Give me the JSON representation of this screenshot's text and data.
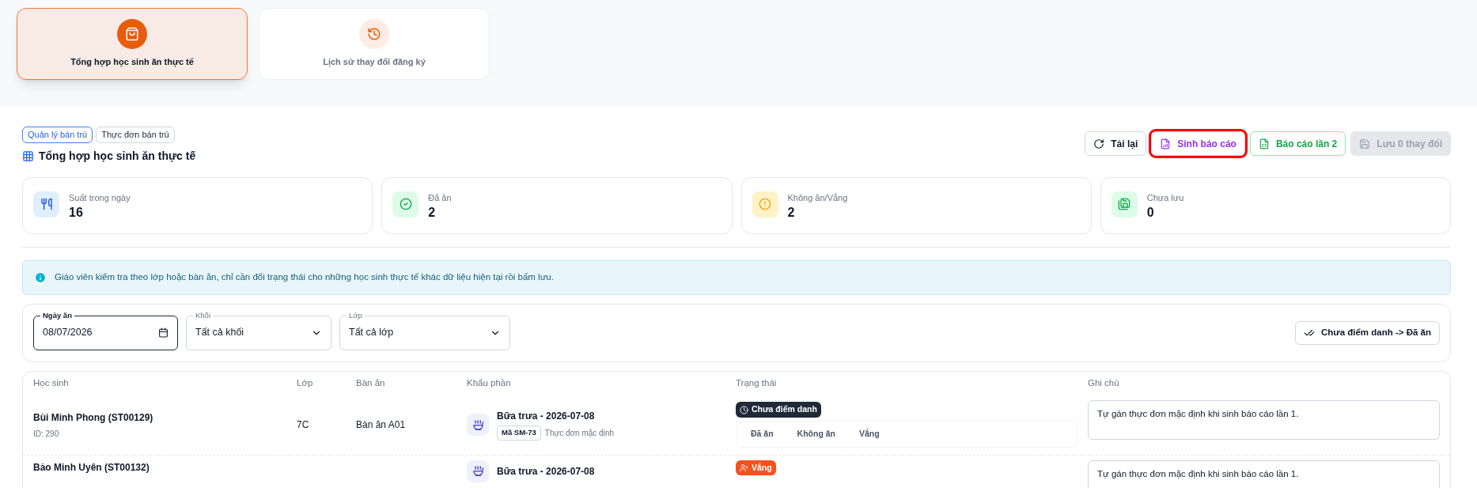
{
  "view_tabs": [
    {
      "label": "Tổng hợp học sinh ăn thực tế",
      "selected": true
    },
    {
      "label": "Lịch sử thay đổi đăng ký",
      "selected": false
    }
  ],
  "breadcrumbs": [
    {
      "label": "Quản lý bán trú",
      "selected": true
    },
    {
      "label": "Thực đơn bán trú",
      "selected": false
    }
  ],
  "page_title": "Tổng hợp học sinh ăn thực tế",
  "actions": [
    {
      "label": "Tải lại",
      "kind": "reload",
      "disabled": false,
      "highlighted": false
    },
    {
      "label": "Sinh báo cáo",
      "kind": "report",
      "disabled": false,
      "highlighted": true
    },
    {
      "label": "Báo cáo lần 2",
      "kind": "excel",
      "disabled": false,
      "highlighted": false
    },
    {
      "label": "Lưu 0 thay đổi",
      "kind": "save",
      "disabled": true,
      "highlighted": false
    }
  ],
  "stats": [
    {
      "label": "Suất trong ngày",
      "value": "16",
      "kind": "meals"
    },
    {
      "label": "Đã ăn",
      "value": "2",
      "kind": "eaten"
    },
    {
      "label": "Không ăn/Vắng",
      "value": "2",
      "kind": "absent"
    },
    {
      "label": "Chưa lưu",
      "value": "0",
      "kind": "unsaved"
    }
  ],
  "info": "Giáo viên kiểm tra theo lớp hoặc bàn ăn, chỉ cần đổi trạng thái cho những học sinh thực tế khác dữ liệu hiện tại rồi bấm lưu.",
  "filters": {
    "date": {
      "label": "Ngày ăn",
      "value": "08/07/2026"
    },
    "grade": {
      "label": "Khối",
      "value": "Tất cả khối"
    },
    "class": {
      "label": "Lớp",
      "value": "Tất cả lớp"
    },
    "bulk_button": "Chưa điểm danh -> Đã ăn"
  },
  "table": {
    "columns": [
      "Học sinh",
      "Lớp",
      "Bàn ăn",
      "Khẩu phần",
      "Trạng thái",
      "Ghi chú"
    ],
    "rows": [
      {
        "name": "Bùi Minh Phong (ST00129)",
        "id": "ID: 290",
        "class": "7C",
        "table": "Bàn ăn A01",
        "meal": "Bữa trưa - 2026-07-08",
        "code": "Mã SM-73",
        "menu": "Thực đơn mặc định",
        "status": {
          "label": "Chưa điểm danh",
          "kind": "pending"
        },
        "options": [
          {
            "label": "Đã ăn",
            "selected": false
          },
          {
            "label": "Không ăn",
            "selected": false
          },
          {
            "label": "Vắng",
            "selected": false
          }
        ],
        "note": "Tự gán thực đơn mặc định khi sinh báo cáo lần 1."
      },
      {
        "name": "Bảo Minh Uyên (ST00132)",
        "meal": "Bữa trưa - 2026-07-08",
        "status": {
          "label": "Vắng",
          "kind": "absent"
        },
        "note": "Tự gán thực đơn mặc định khi sinh báo cáo lần 1."
      }
    ]
  }
}
